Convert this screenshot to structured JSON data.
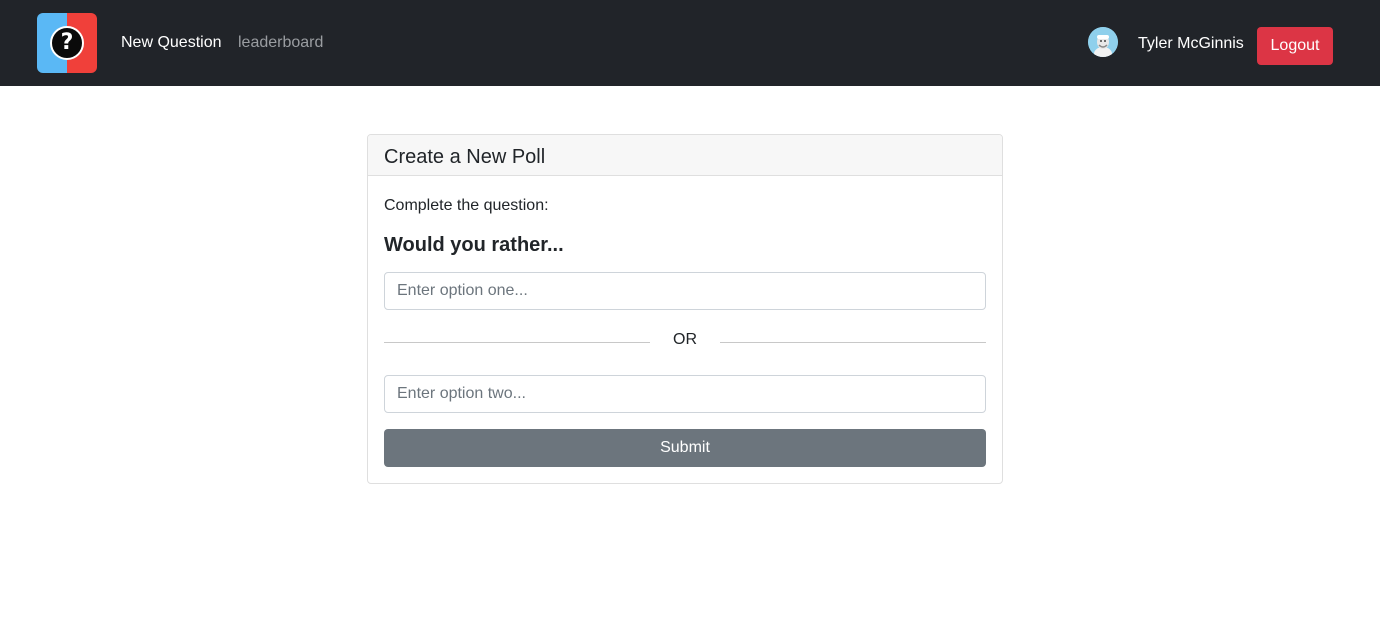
{
  "navbar": {
    "logo": {
      "icon": "question-mark-logo-icon",
      "glyph": "?",
      "colors": {
        "left": "#5ab8f5",
        "right": "#f0403a",
        "center": "#0a0a0a"
      }
    },
    "links": [
      {
        "label": "New Question",
        "active": true
      },
      {
        "label": "leaderboard",
        "active": false
      }
    ],
    "user": {
      "name": "Tyler McGinnis",
      "avatar_icon": "user-avatar-icon"
    },
    "logout_label": "Logout",
    "background": "#212429"
  },
  "poll_form": {
    "title": "Create a New Poll",
    "instructions": "Complete the question:",
    "prompt": "Would you rather...",
    "option_one": {
      "value": "",
      "placeholder": "Enter option one..."
    },
    "separator": "OR",
    "option_two": {
      "value": "",
      "placeholder": "Enter option two..."
    },
    "submit_label": "Submit"
  },
  "colors": {
    "logout": "#dc3545",
    "submit": "#6c757d",
    "card_header": "#f7f7f7"
  }
}
